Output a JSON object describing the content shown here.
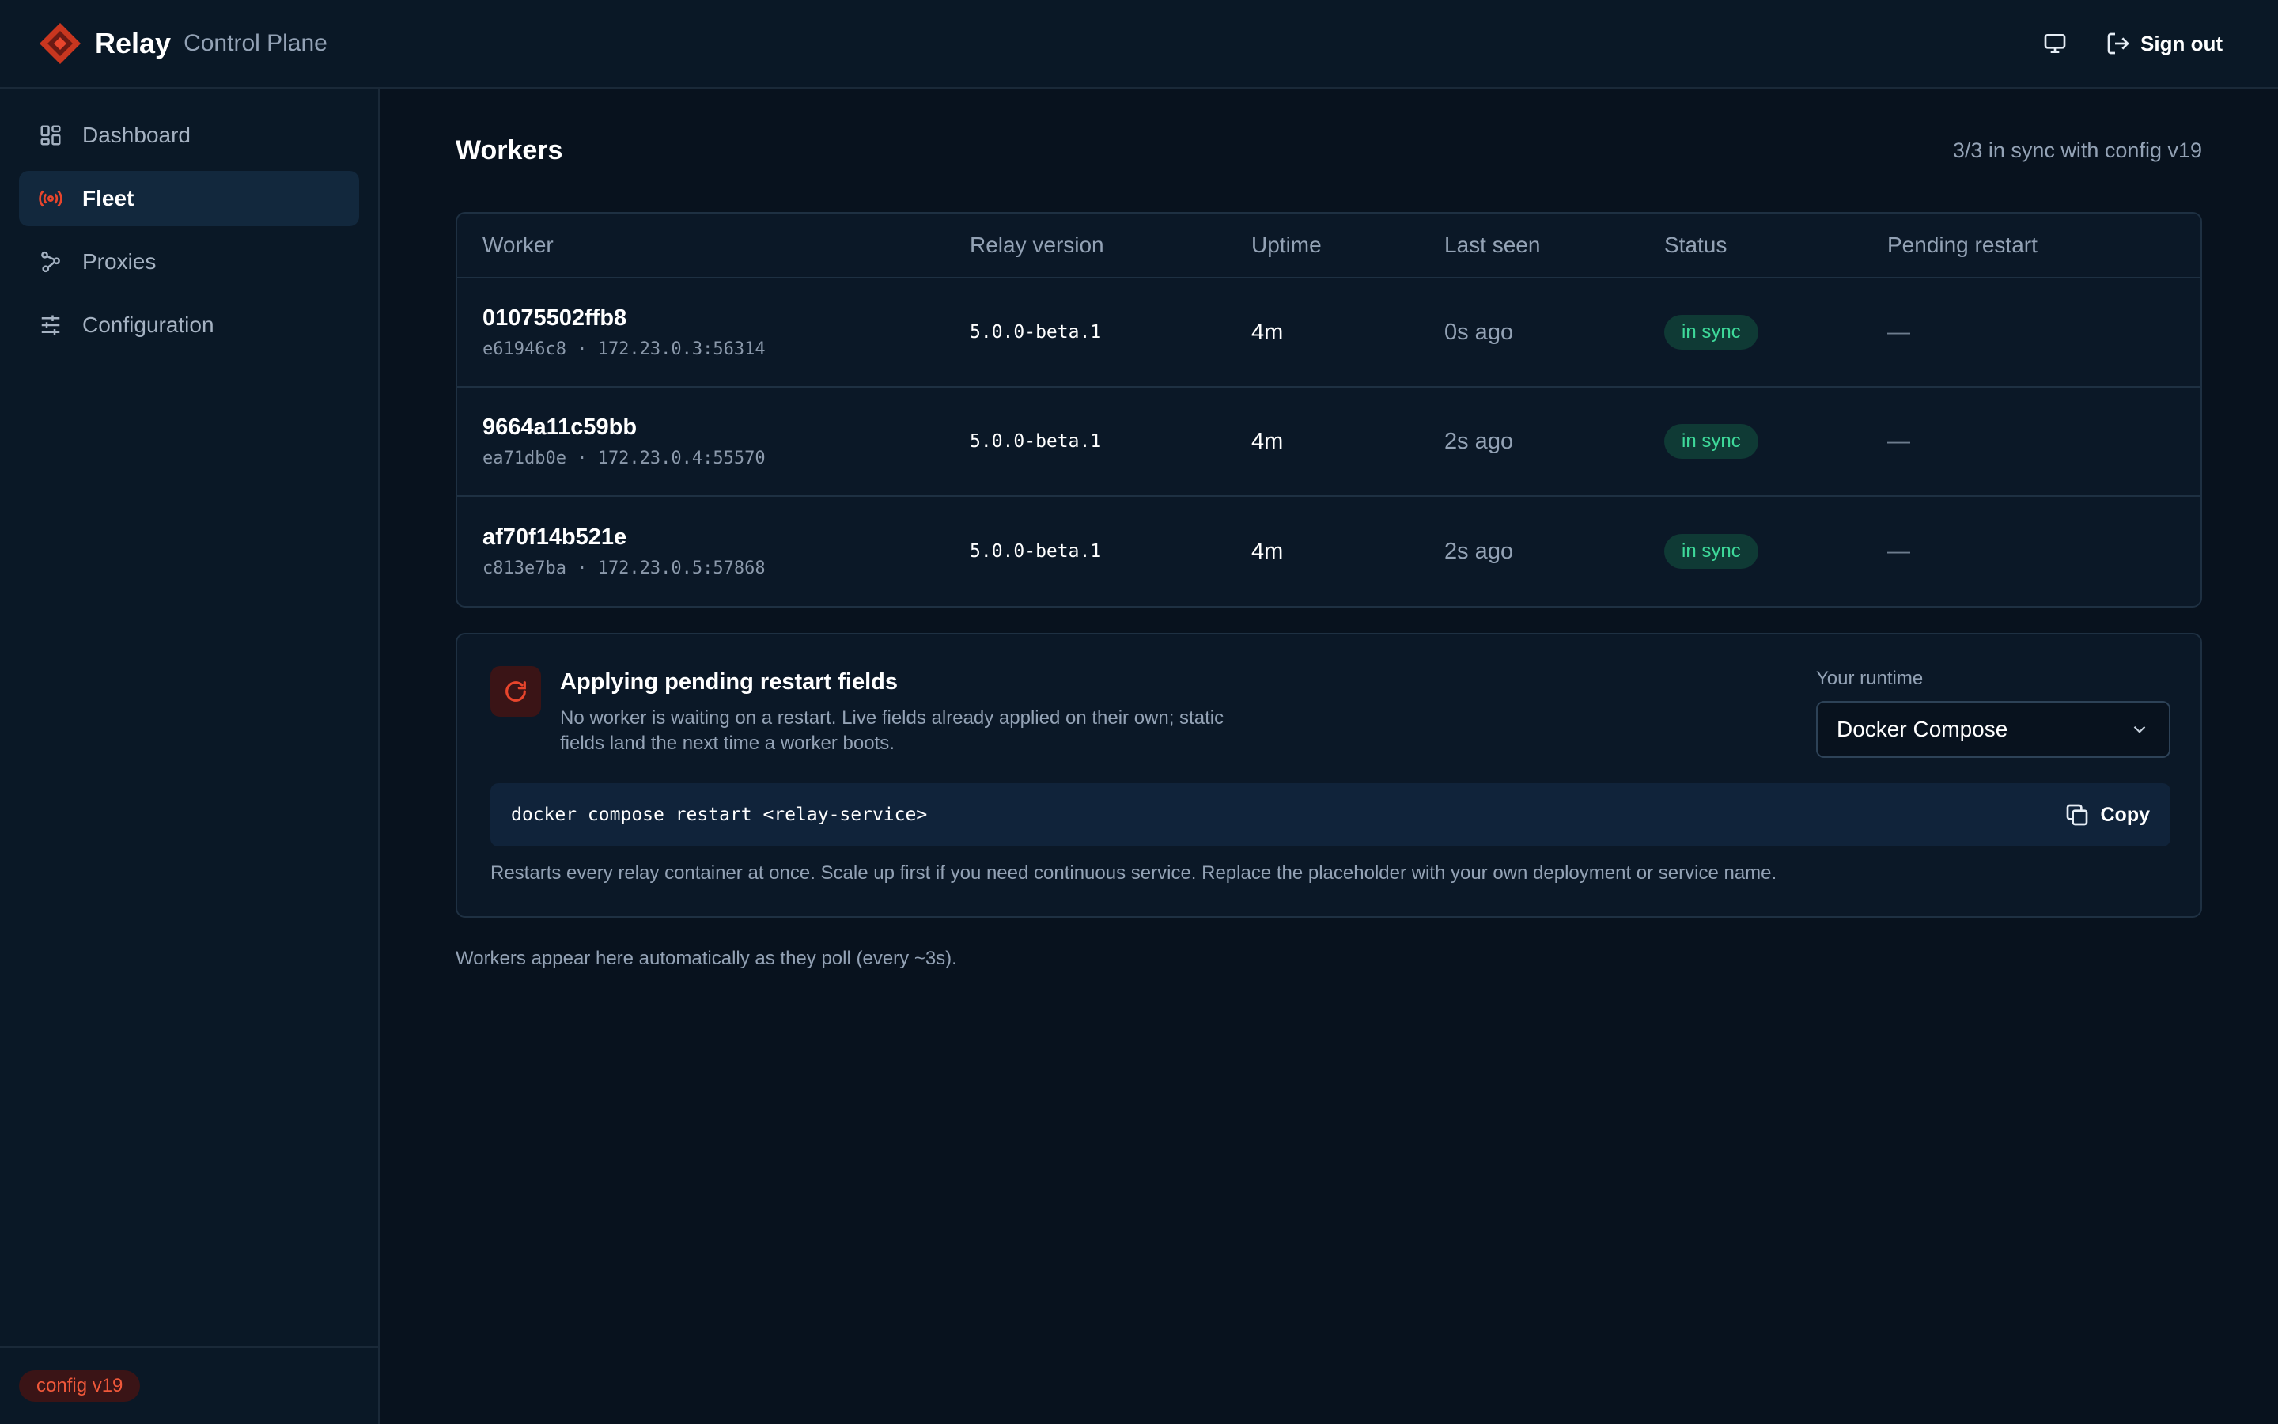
{
  "app": {
    "name": "Relay",
    "subtitle": "Control Plane",
    "sign_out_label": "Sign out"
  },
  "sidebar": {
    "items": [
      {
        "label": "Dashboard",
        "icon": "dashboard-icon"
      },
      {
        "label": "Fleet",
        "icon": "broadcast-icon",
        "active": true
      },
      {
        "label": "Proxies",
        "icon": "network-icon"
      },
      {
        "label": "Configuration",
        "icon": "sliders-icon"
      }
    ],
    "config_badge": "config v19"
  },
  "page": {
    "title": "Workers",
    "sync_summary": "3/3 in sync with config v19"
  },
  "table": {
    "headers": [
      "Worker",
      "Relay version",
      "Uptime",
      "Last seen",
      "Status",
      "Pending restart"
    ],
    "rows": [
      {
        "name": "01075502ffb8",
        "meta": "e61946c8 · 172.23.0.3:56314",
        "version": "5.0.0-beta.1",
        "uptime": "4m",
        "last_seen": "0s ago",
        "status": "in sync",
        "pending": "—"
      },
      {
        "name": "9664a11c59bb",
        "meta": "ea71db0e · 172.23.0.4:55570",
        "version": "5.0.0-beta.1",
        "uptime": "4m",
        "last_seen": "2s ago",
        "status": "in sync",
        "pending": "—"
      },
      {
        "name": "af70f14b521e",
        "meta": "c813e7ba · 172.23.0.5:57868",
        "version": "5.0.0-beta.1",
        "uptime": "4m",
        "last_seen": "2s ago",
        "status": "in sync",
        "pending": "—"
      }
    ]
  },
  "restart": {
    "title": "Applying pending restart fields",
    "description": "No worker is waiting on a restart. Live fields already applied on their own; static fields land the next time a worker boots.",
    "runtime_label": "Your runtime",
    "runtime_value": "Docker Compose",
    "command": "docker compose restart <relay-service>",
    "copy_label": "Copy",
    "note": "Restarts every relay container at once. Scale up first if you need continuous service. Replace the placeholder with your own deployment or service name."
  },
  "footnote": "Workers appear here automatically as they poll (every ~3s).",
  "colors": {
    "accent": "#e8452c",
    "success": "#3ed99a",
    "background": "#08121e"
  }
}
